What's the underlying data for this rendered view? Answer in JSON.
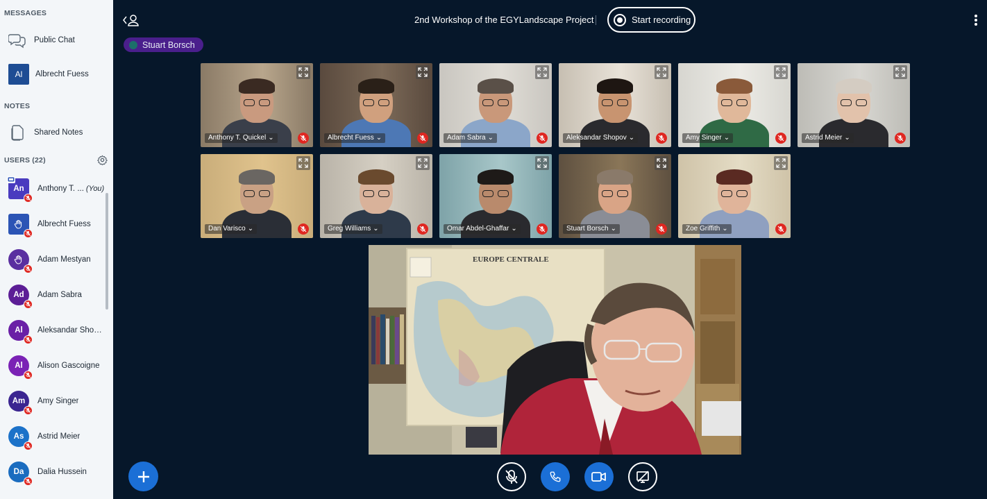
{
  "header": {
    "title": "2nd Workshop of the EGYLandscape Project",
    "recording_label": "Start recording",
    "talking_indicator": "Stuart Borsch"
  },
  "sidebar": {
    "messages_title": "MESSAGES",
    "public_chat_label": "Public Chat",
    "private_chat": {
      "initials": "Al",
      "name": "Albrecht Fuess"
    },
    "notes_title": "NOTES",
    "shared_notes_label": "Shared Notes",
    "users_title": "USERS (22)",
    "you_label": "(You)",
    "users": [
      {
        "initials": "An",
        "name": "Anthony T. Quickel",
        "display": "Anthony T. ...",
        "color": "#4a3bbf",
        "is_you": true,
        "shape": "square"
      },
      {
        "initials": "",
        "name": "Albrecht Fuess",
        "display": "Albrecht Fuess",
        "color": "#2b54b5",
        "icon": "hand-icon",
        "shape": "square"
      },
      {
        "initials": "",
        "name": "Adam Mestyan",
        "display": "Adam Mestyan",
        "color": "#5a2fa0",
        "icon": "hand-icon",
        "shape": "round"
      },
      {
        "initials": "Ad",
        "name": "Adam Sabra",
        "display": "Adam Sabra",
        "color": "#5c1e96",
        "shape": "round"
      },
      {
        "initials": "Al",
        "name": "Aleksandar Shopov",
        "display": "Aleksandar Sho…",
        "color": "#6a1fa6",
        "shape": "round"
      },
      {
        "initials": "Al",
        "name": "Alison Gascoigne",
        "display": "Alison Gascoigne",
        "color": "#7a22b5",
        "shape": "round"
      },
      {
        "initials": "Am",
        "name": "Amy Singer",
        "display": "Amy Singer",
        "color": "#3b2590",
        "shape": "round"
      },
      {
        "initials": "As",
        "name": "Astrid Meier",
        "display": "Astrid Meier",
        "color": "#1c72c9",
        "shape": "round"
      },
      {
        "initials": "Da",
        "name": "Dalia Hussein",
        "display": "Dalia Hussein",
        "color": "#1a6cbf",
        "shape": "round"
      }
    ]
  },
  "videos": [
    {
      "name": "Anthony T. Quickel",
      "bg": "#8a7a66",
      "wall": "#b8a68c",
      "skin": "#c99a7f",
      "hair": "#3a2a22",
      "shirt": "#3a3f4a"
    },
    {
      "name": "Albrecht Fuess",
      "bg": "#5a4a3e",
      "wall": "#7c6a58",
      "skin": "#d0a07e",
      "hair": "#2a2018",
      "shirt": "#4d78b5"
    },
    {
      "name": "Adam Sabra",
      "bg": "#c9c6c0",
      "wall": "#e0ddd6",
      "skin": "#c9987a",
      "hair": "#5a5048",
      "shirt": "#8ba6c9"
    },
    {
      "name": "Aleksandar Shopov",
      "bg": "#c7bfb2",
      "wall": "#e8e2d8",
      "skin": "#c89470",
      "hair": "#1e1612",
      "shirt": "#2a2a2e"
    },
    {
      "name": "Amy Singer",
      "bg": "#d7d6d0",
      "wall": "#ecebe6",
      "skin": "#e0b89a",
      "hair": "#8a5a3a",
      "shirt": "#2f6a45"
    },
    {
      "name": "Astrid Meier",
      "bg": "#bdbcb6",
      "wall": "#d8d7d2",
      "skin": "#e2c2ab",
      "hair": "#d4ccc2",
      "shirt": "#2a2a2e"
    },
    {
      "name": "Dan Varisco",
      "bg": "#c9ad7a",
      "wall": "#e0c38d",
      "skin": "#c9a184",
      "hair": "#6a6662",
      "shirt": "#2a2e36"
    },
    {
      "name": "Greg Williams",
      "bg": "#b9b3a8",
      "wall": "#d6d0c4",
      "skin": "#d9b29a",
      "hair": "#6a4a2e",
      "shirt": "#2e3a4a"
    },
    {
      "name": "Omar Abdel-Ghaffar",
      "bg": "#7ea3a8",
      "wall": "#a8c7c9",
      "skin": "#b98a6c",
      "hair": "#1e1a18",
      "shirt": "#2a2a2e"
    },
    {
      "name": "Stuart Borsch",
      "bg": "#5e5040",
      "wall": "#8a7658",
      "skin": "#d9a486",
      "hair": "#8a7a6a",
      "shirt": "#8a8d96"
    },
    {
      "name": "Zoe Griffith",
      "bg": "#cfc3a8",
      "wall": "#e4dcc5",
      "skin": "#e0b49a",
      "hair": "#5a2a22",
      "shirt": "#8fa0c0"
    }
  ],
  "main_video": {
    "speaker": "Stuart Borsch",
    "map_caption": "EUROPE CENTRALE"
  },
  "controls": {
    "unmute_icon": "microphone-off-icon",
    "leave_audio_icon": "phone-icon",
    "camera_icon": "video-camera-icon",
    "screenshare_icon": "screen-share-off-icon",
    "actions_icon": "plus-icon"
  },
  "colors": {
    "background": "#06172a",
    "sidebar": "#f3f6f9",
    "primary": "#1b6fd6",
    "muted": "#df2721",
    "talker": "#4a1f8c"
  }
}
